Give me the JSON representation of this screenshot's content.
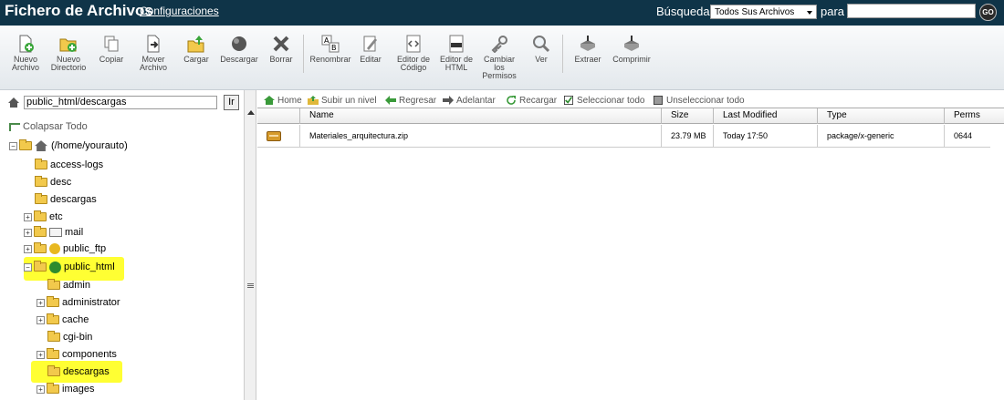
{
  "header": {
    "title": "Fichero de Archivos",
    "config_link": "Configuraciones",
    "search_label": "Búsqueda",
    "search_scope": "Todos Sus Archivos",
    "para_label": "para",
    "search_value": "",
    "go_label": "GO"
  },
  "toolbar": {
    "new_file": "Nuevo\nArchivo",
    "new_folder": "Nuevo\nDirectorio",
    "copy": "Copiar",
    "move": "Mover\nArchivo",
    "upload": "Cargar",
    "download": "Descargar",
    "delete": "Borrar",
    "rename": "Renombrar",
    "edit": "Editar",
    "code_editor": "Editor de\nCódigo",
    "html_editor": "Editor de\nHTML",
    "permissions": "Cambiar\nlos\nPermisos",
    "view": "Ver",
    "extract": "Extraer",
    "compress": "Comprimir"
  },
  "left": {
    "path": "public_html/descargas",
    "go_btn": "Ir",
    "collapse_all": "Colapsar Todo",
    "root": "(/home/yourauto)",
    "items": {
      "access_logs": "access-logs",
      "desc": "desc",
      "descargas": "descargas",
      "etc": "etc",
      "mail": "mail",
      "public_ftp": "public_ftp",
      "public_html": "public_html",
      "admin": "admin",
      "administrator": "administrator",
      "cache": "cache",
      "cgi_bin": "cgi-bin",
      "components": "components",
      "descargas_sub": "descargas",
      "images": "images"
    }
  },
  "nav": {
    "home": "Home",
    "up": "Subir un nivel",
    "back": "Regresar",
    "forward": "Adelantar",
    "reload": "Recargar",
    "select_all": "Seleccionar todo",
    "unselect_all": "Unseleccionar todo"
  },
  "table": {
    "headers": {
      "name": "Name",
      "size": "Size",
      "modified": "Last Modified",
      "type": "Type",
      "perms": "Perms"
    },
    "rows": [
      {
        "name": "Materiales_arquitectura.zip",
        "size": "23.79 MB",
        "modified": "Today 17:50",
        "type": "package/x-generic",
        "perms": "0644"
      }
    ]
  }
}
